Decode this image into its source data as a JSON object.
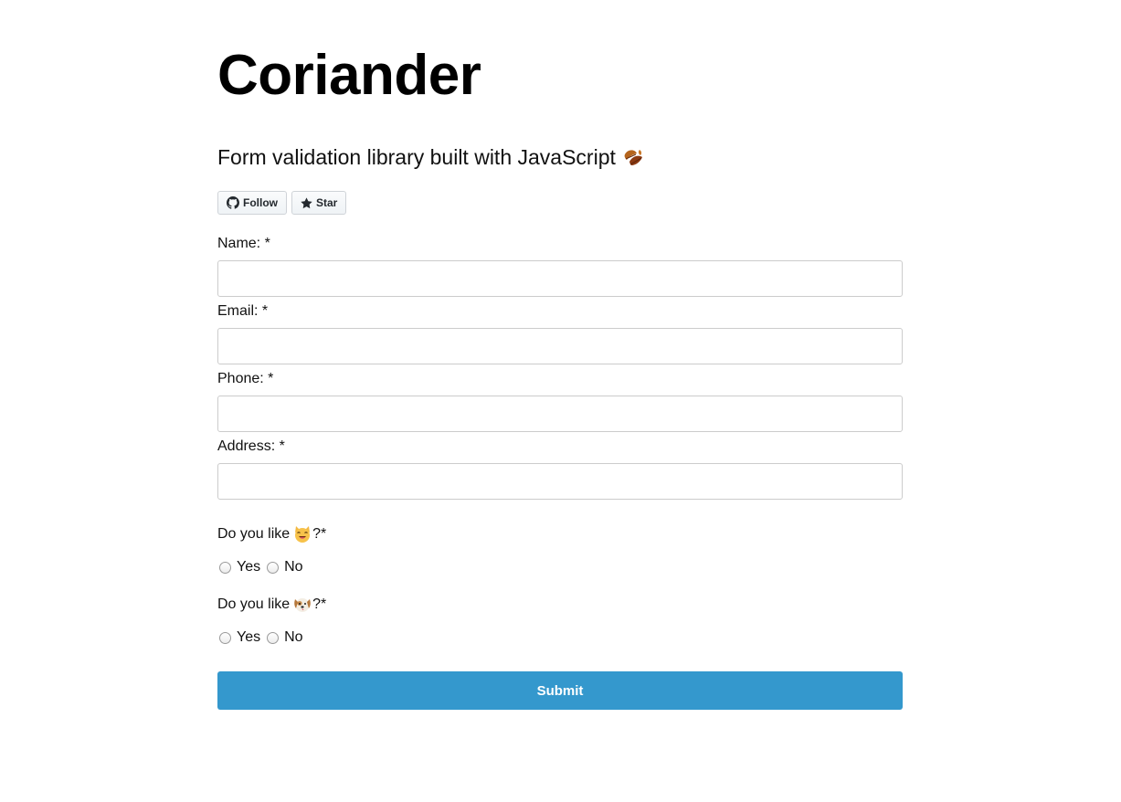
{
  "header": {
    "title": "Coriander",
    "subtitle": "Form validation library built with JavaScript",
    "subtitle_icon": "fallen-leaf-emoji"
  },
  "github": {
    "follow_label": "Follow",
    "star_label": "Star"
  },
  "form": {
    "fields": [
      {
        "label": "Name: *",
        "value": ""
      },
      {
        "label": "Email: *",
        "value": ""
      },
      {
        "label": "Phone: *",
        "value": ""
      },
      {
        "label": "Address: *",
        "value": ""
      }
    ],
    "questions": [
      {
        "prefix": "Do you like",
        "emoji": "cat-face-emoji",
        "suffix": "?*",
        "options": [
          "Yes",
          "No"
        ]
      },
      {
        "prefix": "Do you like",
        "emoji": "dog-face-emoji",
        "suffix": "?*",
        "options": [
          "Yes",
          "No"
        ]
      }
    ],
    "submit_label": "Submit"
  },
  "colors": {
    "submit_bg": "#3498cd",
    "input_border": "#cccccc"
  }
}
